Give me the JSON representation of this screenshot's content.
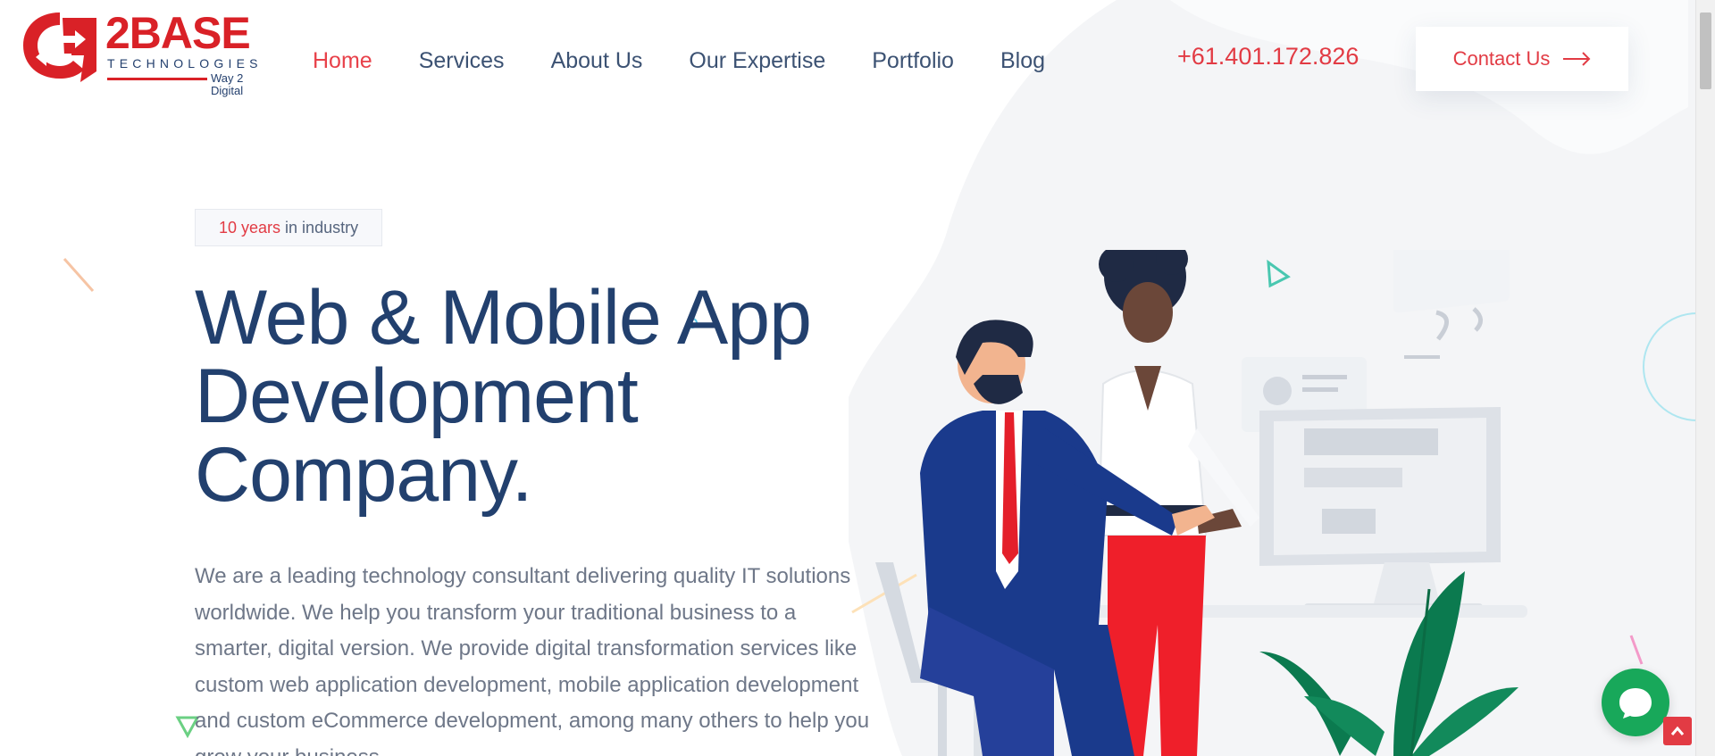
{
  "brand": {
    "name": "2BASE",
    "subtitle": "TECHNOLOGIES",
    "tagline": "Way 2 Digital",
    "accent_color": "#d92127",
    "primary_color": "#22406e"
  },
  "nav": {
    "items": [
      {
        "label": "Home",
        "active": true
      },
      {
        "label": "Services",
        "active": false
      },
      {
        "label": "About Us",
        "active": false
      },
      {
        "label": "Our Expertise",
        "active": false
      },
      {
        "label": "Portfolio",
        "active": false
      },
      {
        "label": "Blog",
        "active": false
      }
    ]
  },
  "header": {
    "phone": "+61.401.172.826",
    "contact_label": "Contact Us",
    "contact_icon": "arrow-right-icon"
  },
  "hero": {
    "badge_accent": "10 years",
    "badge_rest": "in industry",
    "title_line1": "Web & Mobile App",
    "title_line2": "Development",
    "title_line3": "Company.",
    "description": "We are a leading technology consultant delivering quality IT solutions worldwide. We help you transform your traditional business to a smarter, digital version. We provide digital transformation services like custom web application development, mobile application development and custom eCommerce development, among many others to help you grow your business."
  },
  "widgets": {
    "chat_icon": "chat-bubble-icon",
    "chat_color": "#18a85a",
    "scroll_top_icon": "chevron-up-icon"
  }
}
